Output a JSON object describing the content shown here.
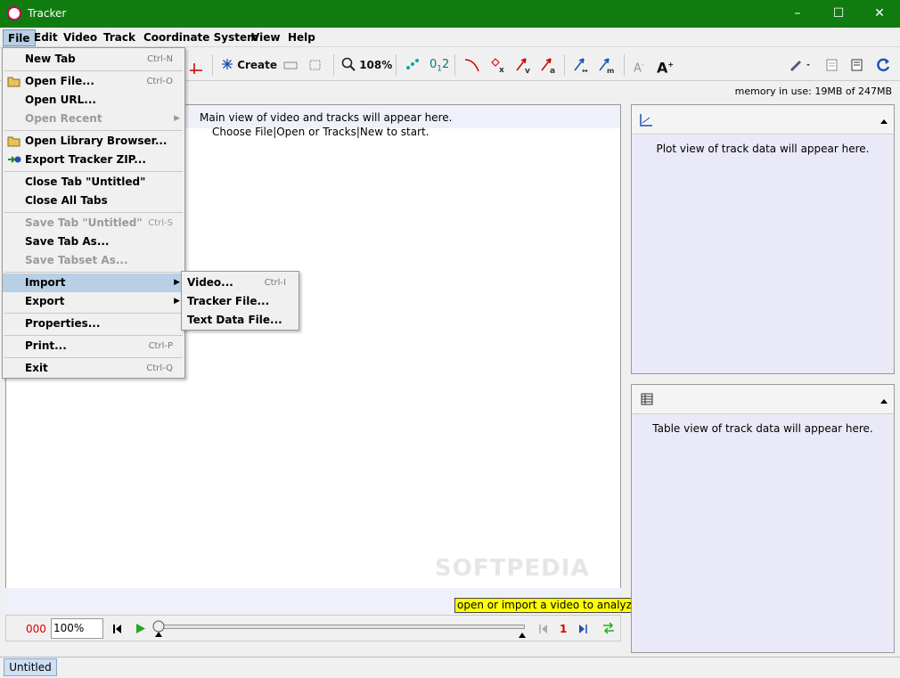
{
  "window": {
    "title": "Tracker",
    "minimize": "–",
    "maximize": "☐",
    "close": "✕"
  },
  "menubar": [
    "File",
    "Edit",
    "Video",
    "Track",
    "Coordinate System",
    "View",
    "Help"
  ],
  "toolbar": {
    "create_label": "Create",
    "zoom_label": "108%",
    "text_small": "A",
    "text_large": "A"
  },
  "memory": "memory in use: 19MB of 247MB",
  "main": {
    "hint1": "Main view of video and tracks will appear here.",
    "hint2": "Choose File|Open or Tracks|New to start.",
    "analyze": "open or import a video to analyze",
    "watermark": "SOFTPEDIA"
  },
  "player": {
    "frame_counter": "000",
    "rate": "100%",
    "step_size": "1"
  },
  "plot_panel": {
    "text": "Plot view of track data will appear here."
  },
  "table_panel": {
    "text": "Table view of track data will appear here."
  },
  "tabs": [
    "Untitled"
  ],
  "file_menu": [
    {
      "label": "New Tab",
      "accel": "Ctrl-N"
    },
    {
      "label": "Open File...",
      "accel": "Ctrl-O"
    },
    {
      "label": "Open URL...",
      "accel": ""
    },
    {
      "label": "Open Recent",
      "accel": ""
    },
    {
      "label": "Open Library Browser...",
      "accel": ""
    },
    {
      "label": "Export Tracker ZIP...",
      "accel": ""
    },
    {
      "label": "Close Tab \"Untitled\"",
      "accel": ""
    },
    {
      "label": "Close All Tabs",
      "accel": ""
    },
    {
      "label": "Save Tab \"Untitled\"",
      "accel": "Ctrl-S"
    },
    {
      "label": "Save Tab As...",
      "accel": ""
    },
    {
      "label": "Save Tabset As...",
      "accel": ""
    },
    {
      "label": "Import",
      "accel": ""
    },
    {
      "label": "Export",
      "accel": ""
    },
    {
      "label": "Properties...",
      "accel": ""
    },
    {
      "label": "Print...",
      "accel": "Ctrl-P"
    },
    {
      "label": "Exit",
      "accel": "Ctrl-Q"
    }
  ],
  "import_menu": [
    {
      "label": "Video...",
      "accel": "Ctrl-I"
    },
    {
      "label": "Tracker File...",
      "accel": ""
    },
    {
      "label": "Text Data File...",
      "accel": ""
    }
  ]
}
